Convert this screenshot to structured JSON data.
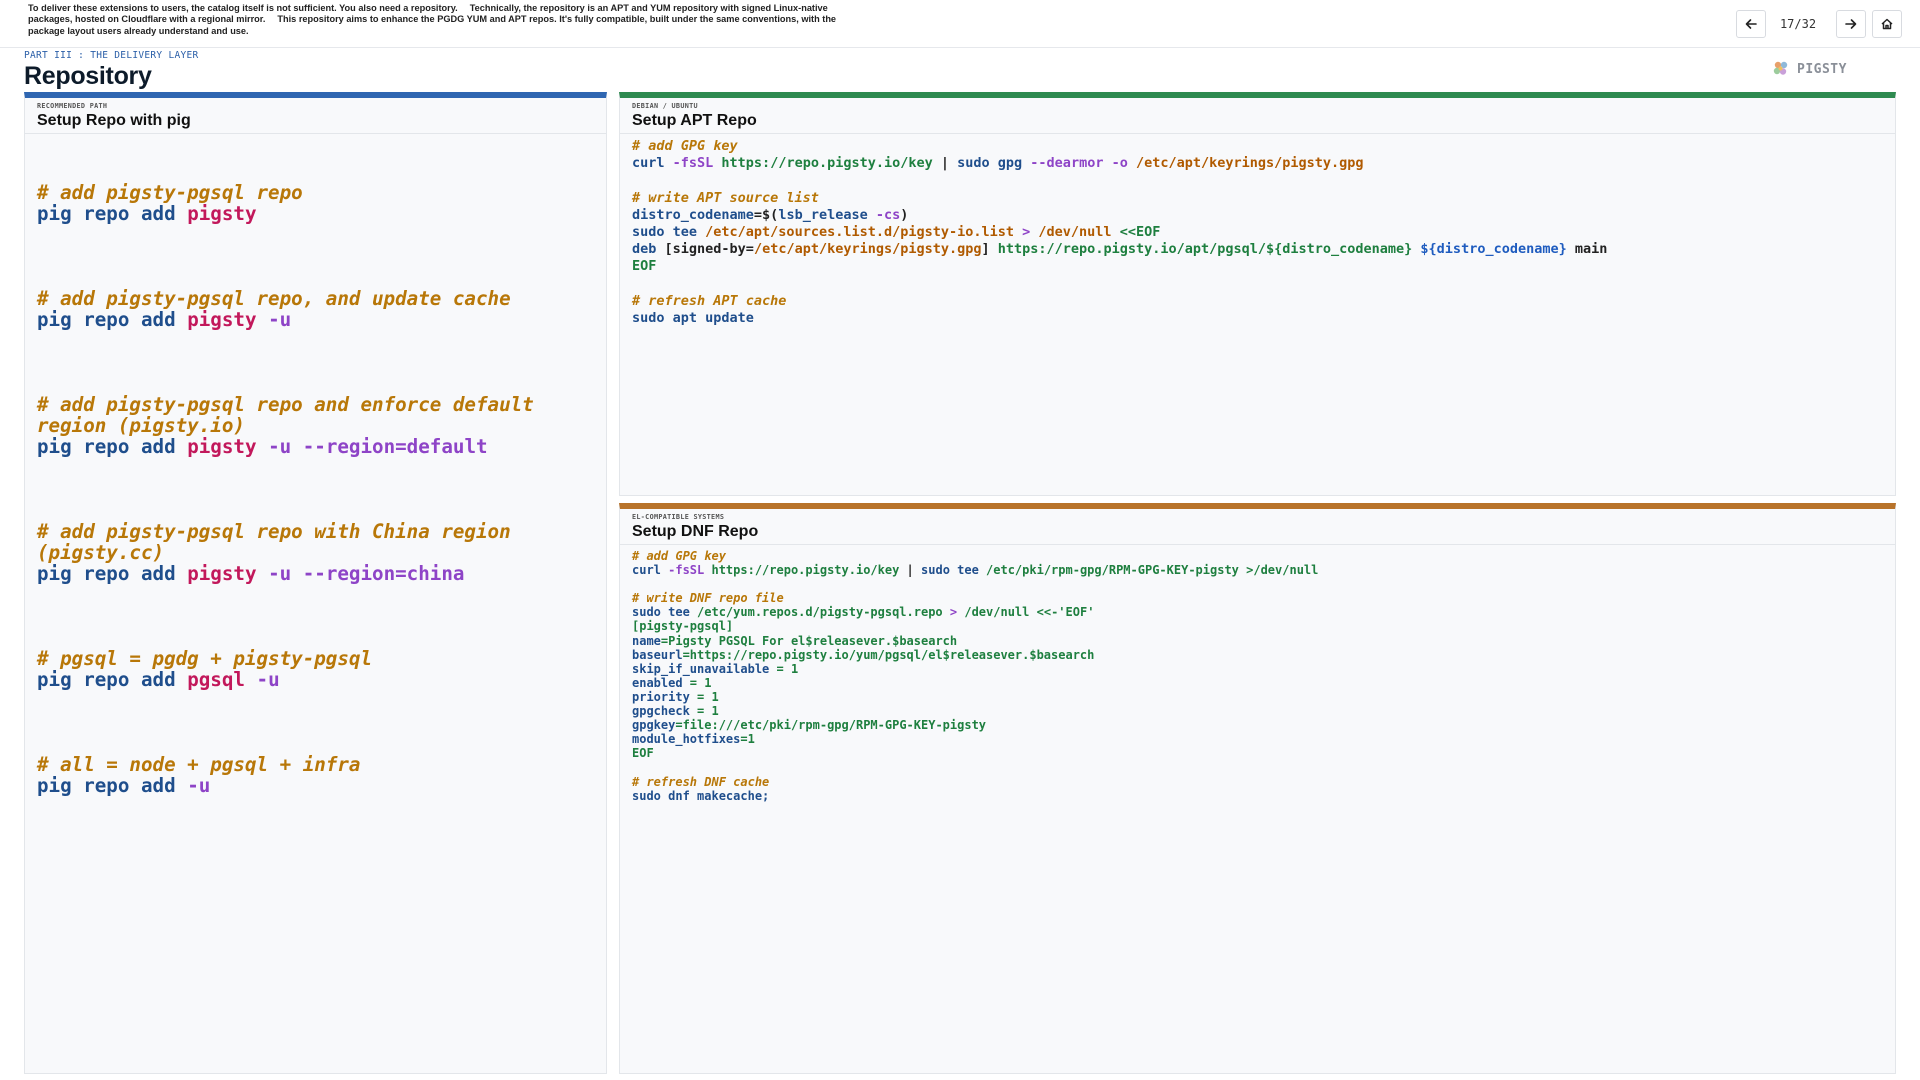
{
  "notes": [
    "To deliver these extensions to users, the catalog itself is not sufficient. You also need a repository.",
    "Technically, the repository is an APT and YUM repository with signed Linux-native packages, hosted on Cloudflare with a regional mirror.",
    "This repository aims to enhance the PGDG YUM and APT repos. It's fully compatible, built under the same conventions, with the package layout users already understand and use."
  ],
  "nav": {
    "counter": "17/32",
    "prev_icon": "arrow-left-icon",
    "next_icon": "arrow-right-icon",
    "home_icon": "home-icon"
  },
  "header": {
    "eyebrow": "PART III : THE DELIVERY LAYER",
    "title": "Repository",
    "brand": "PIGSTY"
  },
  "colors": {
    "pig_accent": "#2f66b1",
    "apt_accent": "#2e8a50",
    "dnf_accent": "#b8732a"
  },
  "cards": {
    "pig": {
      "kicker": "RECOMMENDED PATH",
      "title": "Setup Repo with pig",
      "blocks": [
        {
          "comment": "# add pigsty-pgsql repo",
          "cmd": "pig repo add",
          "pkg": "pigsty",
          "flags": ""
        },
        {
          "comment": "# add pigsty-pgsql repo, and update cache",
          "cmd": "pig repo add",
          "pkg": "pigsty",
          "flags": "-u"
        },
        {
          "comment": "# add pigsty-pgsql repo and enforce default\nregion (pigsty.io)",
          "cmd": "pig repo add",
          "pkg": "pigsty",
          "flags": "-u --region=default"
        },
        {
          "comment": "# add pigsty-pgsql repo with China region\n(pigsty.cc)",
          "cmd": "pig repo add",
          "pkg": "pigsty",
          "flags": "-u --region=china"
        },
        {
          "comment": "# pgsql = pgdg + pigsty-pgsql",
          "cmd": "pig repo add",
          "pkg": "pgsql",
          "flags": "-u"
        },
        {
          "comment": "# all = node + pgsql + infra",
          "cmd": "pig repo add",
          "pkg": "",
          "flags": "-u"
        }
      ]
    },
    "apt": {
      "kicker": "DEBIAN / UBUNTU",
      "title": "Setup APT Repo",
      "comment_gpg": "# add GPG key",
      "gpg_curl": "curl",
      "gpg_flag": " -fsSL ",
      "gpg_url": "https://repo.pigsty.io/key",
      "gpg_pipe": " | ",
      "gpg_sudo": "sudo gpg",
      "gpg_flags": " --dearmor -o ",
      "gpg_path": "/etc/apt/keyrings/pigsty.gpg",
      "comment_src": "# write APT source list",
      "codename_var": "distro_codename",
      "codename_eq": "=$(",
      "codename_cmd": "lsb_release",
      "codename_flag": " -cs",
      "codename_close": ")",
      "tee_cmd": "sudo tee",
      "tee_path": " /etc/apt/sources.list.d/pigsty-io.list",
      "tee_redirect": " > ",
      "tee_null": "/dev/null",
      "tee_heredoc": " <<EOF",
      "deb_kw": "deb",
      "deb_open": " [signed-by=",
      "deb_key": "/etc/apt/keyrings/pigsty.gpg",
      "deb_close": "] ",
      "deb_url": "https://repo.pigsty.io/apt/pgsql/${distro_codename}",
      "deb_var": " ${distro_codename}",
      "deb_main": " main",
      "eof": "EOF",
      "comment_cache": "# refresh APT cache",
      "update_cmd": "sudo apt update"
    },
    "dnf": {
      "kicker": "EL-COMPATIBLE SYSTEMS",
      "title": "Setup DNF Repo",
      "comment_gpg": "# add GPG key",
      "gpg_curl": "curl",
      "gpg_flag": " -fsSL ",
      "gpg_url": "https://repo.pigsty.io/key",
      "gpg_pipe": " | ",
      "gpg_tee": "sudo tee",
      "gpg_path": " /etc/pki/rpm-gpg/RPM-GPG-KEY-pigsty",
      "gpg_null": " >/dev/null",
      "comment_repo": "# write DNF repo file",
      "tee_cmd": "sudo tee",
      "tee_path": " /etc/yum.repos.d/pigsty-pgsql.repo",
      "tee_redirect": " > ",
      "tee_null": "/dev/null",
      "tee_heredoc": " <<-'EOF'",
      "section": "[pigsty-pgsql]",
      "name_key": "name",
      "name_val": "=Pigsty PGSQL For el$releasever.$basearch",
      "baseurl_key": "baseurl",
      "baseurl_val": "=https://repo.pigsty.io/yum/pgsql/el$releasever.$basearch",
      "skip_key": "skip_if_unavailable",
      "skip_val": " = 1",
      "enabled_key": "enabled",
      "enabled_val": " = 1",
      "priority_key": "priority",
      "priority_val": " = 1",
      "gpgcheck_key": "gpgcheck",
      "gpgcheck_val": " = 1",
      "gpgkey_key": "gpgkey",
      "gpgkey_val": "=file:///etc/pki/rpm-gpg/RPM-GPG-KEY-pigsty",
      "hotfix_key": "module_hotfixes",
      "hotfix_val": "=1",
      "eof": "EOF",
      "comment_cache": "# refresh DNF cache",
      "makecache": "sudo dnf makecache;"
    }
  }
}
